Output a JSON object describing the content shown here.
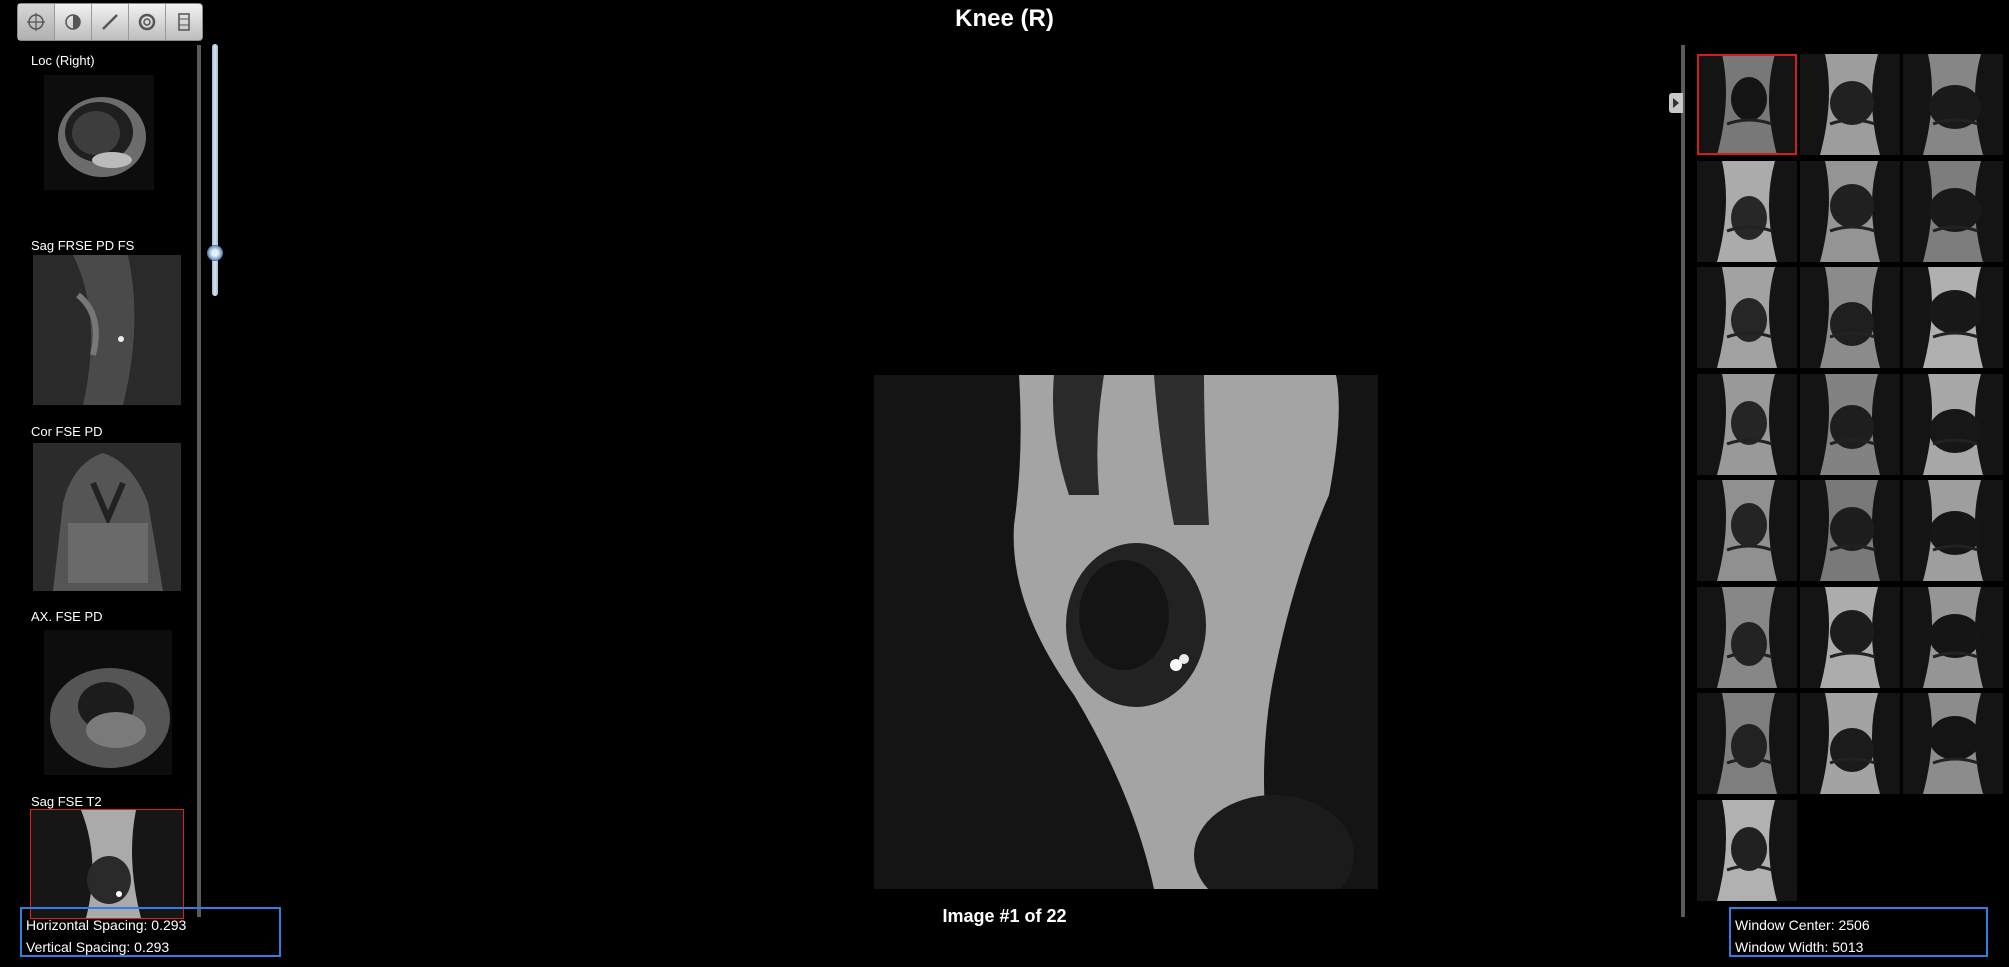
{
  "title": "Knee (R)",
  "toolbar": {
    "tools": [
      {
        "name": "crosshair-icon"
      },
      {
        "name": "contrast-icon"
      },
      {
        "name": "measure-icon"
      },
      {
        "name": "reset-icon"
      },
      {
        "name": "film-icon"
      }
    ]
  },
  "series": [
    {
      "label": "Loc (Right)"
    },
    {
      "label": "Sag FRSE PD FS"
    },
    {
      "label": "Cor FSE PD"
    },
    {
      "label": "AX. FSE PD"
    },
    {
      "label": "Sag FSE T2",
      "selected": true
    }
  ],
  "viewer": {
    "image_index": "Image #1 of 22",
    "slider_value": 0.8
  },
  "spacing": {
    "horizontal": "Horizontal Spacing: 0.293",
    "vertical": "Vertical Spacing: 0.293"
  },
  "window": {
    "center": "Window Center: 2506",
    "width": "Window Width: 5013"
  },
  "thumbnails": {
    "count": 22,
    "selected_index": 0
  },
  "colors": {
    "selection": "#d21e1e",
    "info_border": "#2f7fe0",
    "slider": "#7fa6cc"
  }
}
